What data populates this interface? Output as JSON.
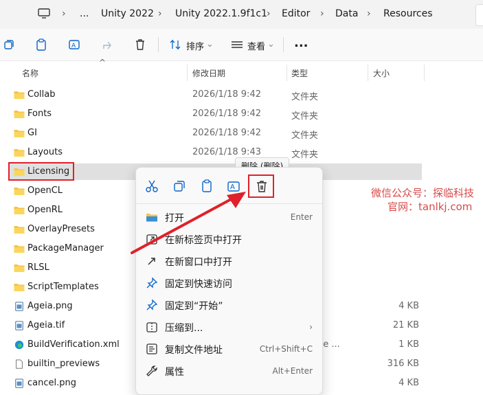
{
  "address_bar": {
    "overflow": "...",
    "breadcrumbs": [
      "Unity 2022",
      "Unity 2022.1.9f1c1",
      "Editor",
      "Data",
      "Resources"
    ]
  },
  "toolbar": {
    "sort_label": "排序",
    "view_label": "查看",
    "more_label": "..."
  },
  "columns": {
    "name": "名称",
    "date": "修改日期",
    "type": "类型",
    "size": "大小"
  },
  "files": [
    {
      "name": "Collab",
      "date": "2026/1/18 9:42",
      "type": "文件夹",
      "size": "",
      "icon": "folder-icon"
    },
    {
      "name": "Fonts",
      "date": "2026/1/18 9:42",
      "type": "文件夹",
      "size": "",
      "icon": "folder-icon"
    },
    {
      "name": "GI",
      "date": "2026/1/18 9:42",
      "type": "文件夹",
      "size": "",
      "icon": "folder-icon"
    },
    {
      "name": "Layouts",
      "date": "2026/1/18 9:43",
      "type": "文件夹",
      "size": "",
      "icon": "folder-icon"
    },
    {
      "name": "Licensing",
      "date": "",
      "type": "",
      "size": "",
      "icon": "folder-icon"
    },
    {
      "name": "OpenCL",
      "date": "",
      "type": "",
      "size": "",
      "icon": "folder-icon"
    },
    {
      "name": "OpenRL",
      "date": "",
      "type": "",
      "size": "",
      "icon": "folder-icon"
    },
    {
      "name": "OverlayPresets",
      "date": "",
      "type": "",
      "size": "",
      "icon": "folder-icon"
    },
    {
      "name": "PackageManager",
      "date": "",
      "type": "",
      "size": "",
      "icon": "folder-icon"
    },
    {
      "name": "RLSL",
      "date": "",
      "type": "",
      "size": "",
      "icon": "folder-icon"
    },
    {
      "name": "ScriptTemplates",
      "date": "",
      "type": "",
      "size": "",
      "icon": "folder-icon"
    },
    {
      "name": "Ageia.png",
      "date": "",
      "type": "件",
      "size": "4 KB",
      "icon": "image-file-icon"
    },
    {
      "name": "Ageia.tif",
      "date": "",
      "type": "",
      "size": "21 KB",
      "icon": "image-file-icon"
    },
    {
      "name": "BuildVerification.xml",
      "date": "",
      "type": "oft Edge ...",
      "size": "1 KB",
      "icon": "edge-file-icon"
    },
    {
      "name": "builtin_previews",
      "date": "",
      "type": "",
      "size": "316 KB",
      "icon": "file-icon"
    },
    {
      "name": "cancel.png",
      "date": "",
      "type": "件",
      "size": "4 KB",
      "icon": "image-file-icon"
    }
  ],
  "tooltip": "删除 (删除)",
  "context_menu": {
    "quick_actions": [
      "cut-icon",
      "copy-icon",
      "paste-icon",
      "rename-icon",
      "delete-icon"
    ],
    "items": [
      {
        "label": "打开",
        "shortcut": "Enter",
        "icon": "folder-open-icon"
      },
      {
        "label": "在新标签页中打开",
        "shortcut": "",
        "icon": "new-tab-icon"
      },
      {
        "label": "在新窗口中打开",
        "shortcut": "",
        "icon": "new-window-icon"
      },
      {
        "label": "固定到快速访问",
        "shortcut": "",
        "icon": "pin-icon"
      },
      {
        "label": "固定到“开始”",
        "shortcut": "",
        "icon": "pin-icon"
      },
      {
        "label": "压缩到...",
        "shortcut": "›",
        "icon": "zip-icon"
      },
      {
        "label": "复制文件地址",
        "shortcut": "Ctrl+Shift+C",
        "icon": "copy-path-icon"
      },
      {
        "label": "属性",
        "shortcut": "Alt+Enter",
        "icon": "wrench-icon"
      }
    ]
  },
  "watermark": {
    "line1": "微信公众号：探临科技",
    "line2": "官网：tanlkj.com"
  },
  "colors": {
    "highlight": "#e0202a",
    "folder": "#f6c343",
    "accent": "#0a64c8"
  }
}
